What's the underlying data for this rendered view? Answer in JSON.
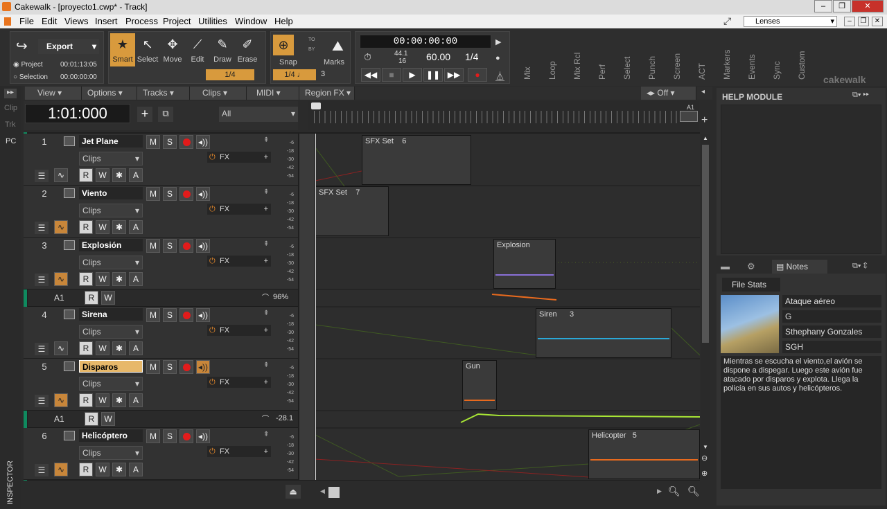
{
  "window": {
    "title": "Cakewalk - [proyecto1.cwp* - Track]",
    "minimize": "‒",
    "restore": "❐",
    "close": "✕"
  },
  "menu": [
    "File",
    "Edit",
    "Views",
    "Insert",
    "Process",
    "Project",
    "Utilities",
    "Window",
    "Help"
  ],
  "lenses": "Lenses",
  "export": {
    "label": "Export",
    "project_label": "Project",
    "project_time": "00:01:13:05",
    "selection_label": "Selection",
    "selection_time": "00:00:00:00"
  },
  "tools": [
    {
      "label": "Smart",
      "icon": "★"
    },
    {
      "label": "Select",
      "icon": "↖"
    },
    {
      "label": "Move",
      "icon": "✥"
    },
    {
      "label": "Edit",
      "icon": "⟋"
    },
    {
      "label": "Draw",
      "icon": "✎"
    },
    {
      "label": "Erase",
      "icon": "✐"
    }
  ],
  "snap": {
    "label": "Snap",
    "value": "1/4",
    "to": "TO",
    "by": "BY",
    "value2": "1/4",
    "num": "3"
  },
  "marks_label": "Marks",
  "tool_quantize": "1/4",
  "transport": {
    "time": "00:00:00:00",
    "rate_top": "44.1",
    "rate_bottom": "16",
    "tempo": "60.00",
    "meter": "1/4"
  },
  "vtabs": [
    "Mix",
    "Loop",
    "Mix Rcl",
    "Perf",
    "Select",
    "Punch",
    "Screen",
    "ACT",
    "Markers",
    "Events",
    "Sync",
    "Custom"
  ],
  "brand": "cakewalk",
  "side_tabs": [
    "Clip",
    "Trk",
    "PC"
  ],
  "inspector": "INSPECTOR",
  "track_menus": [
    "View",
    "Options",
    "Tracks",
    "Clips",
    "MIDI",
    "Region FX"
  ],
  "offlabel": "Off",
  "now_time": "1:01:000",
  "filter": "All",
  "ruler_marker": "A1",
  "help_title": "HELP MODULE",
  "notes_tab": "Notes",
  "file_stats": "File Stats",
  "notes_fields": [
    "Ataque aéreo",
    "G",
    "Sthephany Gonzales",
    "SGH"
  ],
  "notes_text": "Mientras se escucha el viento,el avión se dispone a dispegar. Luego este avión fue atacado por disparos y explota. Llega la policía en sus autos y helicópteros.",
  "tracks": [
    {
      "num": "1",
      "name": "Jet Plane",
      "clips": "Clips",
      "fx": "FX"
    },
    {
      "num": "2",
      "name": "Viento",
      "clips": "Clips",
      "fx": "FX"
    },
    {
      "num": "3",
      "name": "Explosión",
      "clips": "Clips",
      "fx": "FX"
    },
    {
      "num": "4",
      "name": "Sirena",
      "clips": "Clips",
      "fx": "FX"
    },
    {
      "num": "5",
      "name": "Disparos",
      "clips": "Clips",
      "fx": "FX"
    },
    {
      "num": "6",
      "name": "Helicóptero",
      "clips": "Clips",
      "fx": "FX"
    }
  ],
  "auto_lanes": [
    {
      "label": "A1",
      "value": "96%"
    },
    {
      "label": "A1",
      "value": "-28.1"
    }
  ],
  "meter_marks": [
    "-6",
    "-18",
    "-30",
    "-42",
    "-54"
  ],
  "clips": [
    {
      "name": "SFX Set",
      "count": "6"
    },
    {
      "name": "SFX Set",
      "count": "7"
    },
    {
      "name": "Explosion",
      "count": ""
    },
    {
      "name": "Siren",
      "count": "3"
    },
    {
      "name": "Gun",
      "count": ""
    },
    {
      "name": "Helicopter",
      "count": "5"
    }
  ],
  "btn_labels": {
    "m": "M",
    "s": "S",
    "r": "R",
    "w": "W",
    "a": "A"
  },
  "colors": {
    "accent": "#d89a3d",
    "record": "#e21b1b",
    "track_strip": "#0f8a5f",
    "automation": "#a8e635"
  }
}
